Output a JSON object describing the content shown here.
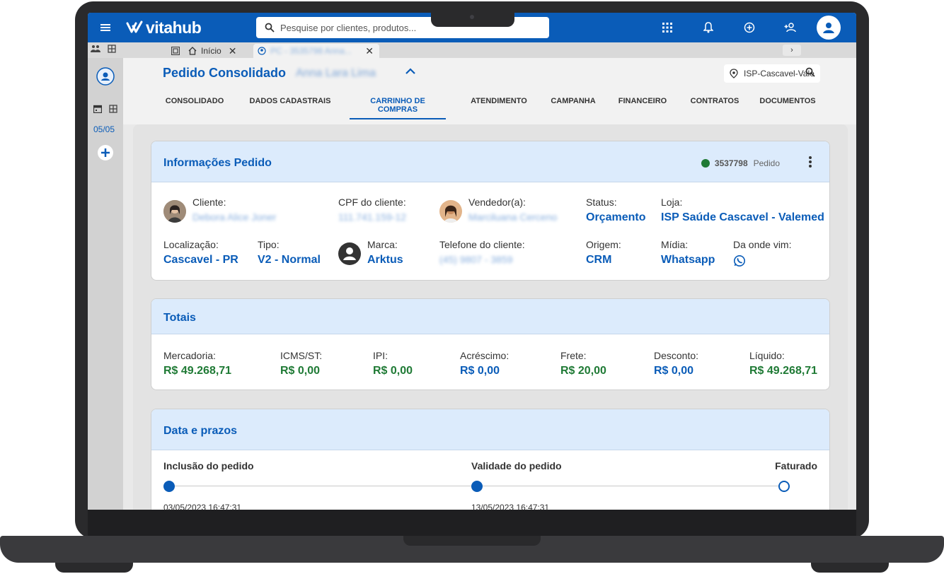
{
  "app": {
    "name": "vitahub"
  },
  "search": {
    "placeholder": "Pesquise por clientes, produtos..."
  },
  "tabs": {
    "home_label": "Início",
    "active_label": "PC - 3535798 Anna..."
  },
  "rail": {
    "date": "05/05"
  },
  "header": {
    "title": "Pedido Consolidado",
    "client_name": "Anna Lara Lima",
    "store": "ISP-Cascavel-Vale"
  },
  "nav": {
    "items": [
      "CONSOLIDADO",
      "DADOS CADASTRAIS",
      "CARRINHO DE COMPRAS",
      "ATENDIMENTO",
      "CAMPANHA",
      "FINANCEIRO",
      "CONTRATOS",
      "DOCUMENTOS"
    ],
    "active": "CARRINHO DE COMPRAS"
  },
  "order_info": {
    "title": "Informações Pedido",
    "number": "3537798",
    "number_label": "Pedido",
    "fields": {
      "cliente_label": "Cliente:",
      "cliente_value": "Debora Alice Joner",
      "cpf_label": "CPF do cliente:",
      "cpf_value": "111.741.159-12",
      "vendedor_label": "Vendedor(a):",
      "vendedor_value": "Marciluana Cerceno",
      "status_label": "Status:",
      "status_value": "Orçamento",
      "loja_label": "Loja:",
      "loja_value": "ISP Saúde Cascavel - Valemed",
      "localizacao_label": "Localização:",
      "localizacao_value": "Cascavel - PR",
      "tipo_label": "Tipo:",
      "tipo_value": "V2 - Normal",
      "marca_label": "Marca:",
      "marca_value": "Arktus",
      "telefone_label": "Telefone do cliente:",
      "telefone_value": "(45) 9807 - 3859",
      "origem_label": "Origem:",
      "origem_value": "CRM",
      "midia_label": "Mídia:",
      "midia_value": "Whatsapp",
      "onde_label": "Da onde vim:"
    }
  },
  "totais": {
    "title": "Totais",
    "items": [
      {
        "label": "Mercadoria:",
        "value": "R$ 49.268,71"
      },
      {
        "label": "ICMS/ST:",
        "value": "R$ 0,00"
      },
      {
        "label": "IPI:",
        "value": "R$ 0,00"
      },
      {
        "label": "Acréscimo:",
        "value": "R$ 0,00"
      },
      {
        "label": "Frete:",
        "value": "R$ 20,00"
      },
      {
        "label": "Desconto:",
        "value": "R$ 0,00"
      },
      {
        "label": "Líquido:",
        "value": "R$ 49.268,71"
      }
    ]
  },
  "prazos": {
    "title": "Data e prazos",
    "steps": [
      {
        "label": "Inclusão do pedido",
        "date": "03/05/2023 16:47:31",
        "done": true
      },
      {
        "label": "Validade do pedido",
        "date": "13/05/2023 16:47:31",
        "done": true
      },
      {
        "label": "Faturado",
        "date": "",
        "done": false
      }
    ]
  },
  "colors": {
    "primary": "#0a5cb8",
    "positive": "#1f7a35",
    "header_bg": "#dcebfc"
  }
}
